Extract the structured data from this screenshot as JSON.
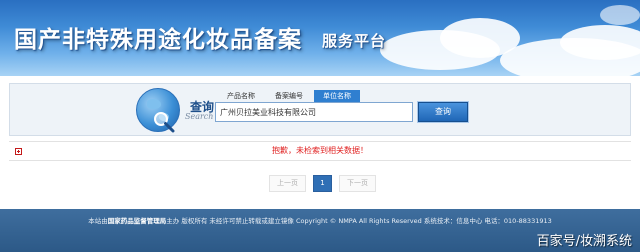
{
  "banner": {
    "title": "国产非特殊用途化妆品备案",
    "subtitle": "服务平台"
  },
  "search": {
    "query_title": "查询",
    "query_sub": "Search",
    "tabs": [
      {
        "label": "产品名称"
      },
      {
        "label": "备案编号"
      },
      {
        "label": "单位名称"
      }
    ],
    "input_value": "广州贝拉美业科技有限公司",
    "button_label": "查询"
  },
  "result": {
    "message": "抱歉，未检索到相关数据！"
  },
  "pagination": {
    "prev": "上一页",
    "current": "1",
    "next": "下一页"
  },
  "footer": {
    "prefix": "本站由",
    "org": "国家药品监督管理局",
    "suffix": "主办 版权所有 未经许可禁止转载或建立镜像 Copyright © NMPA All Rights Reserved 系统技术：信息中心 电话：010-88331913"
  },
  "watermark": "百家号/妆溯系统",
  "colors": {
    "banner_blue": "#3f8bd6",
    "accent_blue": "#2f7fd0",
    "error_red": "#e02020",
    "footer_blue": "#3f6e9e"
  }
}
